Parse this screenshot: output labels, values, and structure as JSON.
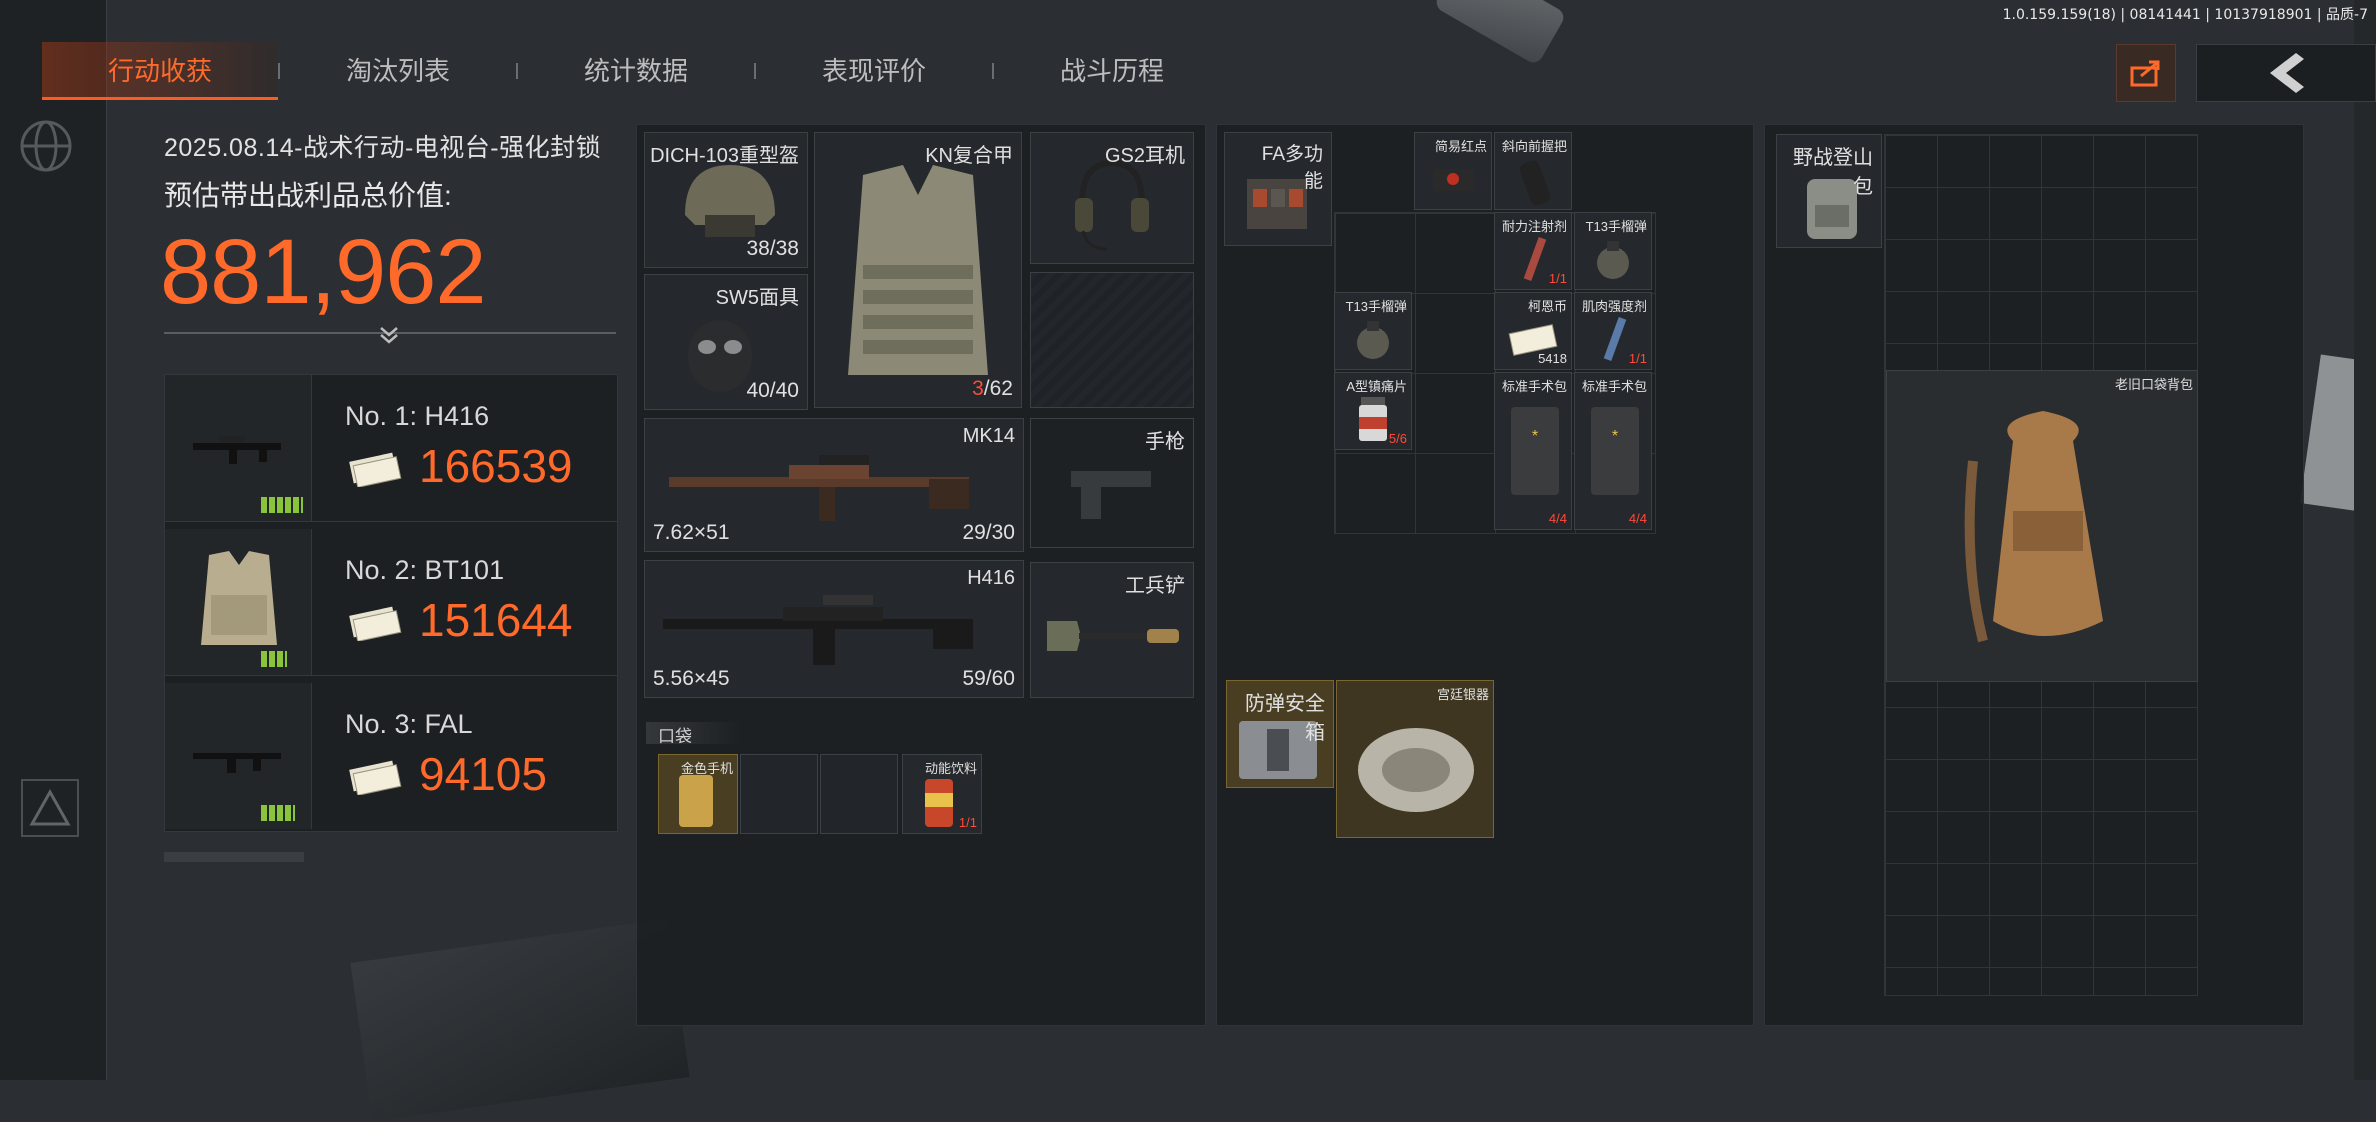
{
  "version_text": "1.0.159.159(18) | 08141441 | 10137918901 | 品质-7",
  "tabs": [
    {
      "label": "行动收获",
      "active": true
    },
    {
      "label": "淘汰列表",
      "active": false
    },
    {
      "label": "统计数据",
      "active": false
    },
    {
      "label": "表现评价",
      "active": false
    },
    {
      "label": "战斗历程",
      "active": false
    }
  ],
  "summary": {
    "operation": "2025.08.14-战术行动-电视台-强化封锁",
    "value_label": "预估带出战利品总价值:",
    "total_value": "881,962"
  },
  "top_items": [
    {
      "name": "No. 1: H416",
      "price": "166539"
    },
    {
      "name": "No. 2: BT101",
      "price": "151644"
    },
    {
      "name": "No. 3: FAL",
      "price": "94105"
    }
  ],
  "equipment": {
    "helmet": {
      "label": "DICH-103重型盔",
      "count": "38/38"
    },
    "armor": {
      "label": "KN复合甲",
      "count_cur": "3",
      "count_max": "/62"
    },
    "earphone": {
      "label": "GS2耳机"
    },
    "mask": {
      "label": "SW5面具",
      "count": "40/40"
    },
    "primary": {
      "label": "MK14",
      "caliber": "7.62×51",
      "ammo": "29/30"
    },
    "pistol": {
      "label": "手枪"
    },
    "secondary": {
      "label": "H416",
      "caliber": "5.56×45",
      "ammo": "59/60"
    },
    "melee": {
      "label": "工兵铲"
    },
    "pocket_label": "口袋",
    "pockets": [
      {
        "label": "金色手机",
        "count": ""
      },
      {
        "label": "",
        "count": ""
      },
      {
        "label": "",
        "count": ""
      },
      {
        "label": "动能饮料",
        "count": "1/1"
      }
    ]
  },
  "rig": {
    "label": "FA多功能",
    "items": [
      {
        "label": "简易红点",
        "count": ""
      },
      {
        "label": "斜向前握把",
        "count": ""
      },
      {
        "label": "耐力注射剂",
        "count": "1/1"
      },
      {
        "label": "T13手榴弹",
        "count": ""
      },
      {
        "label": "T13手榴弹",
        "count": ""
      },
      {
        "label": "柯恩币",
        "count": "5418"
      },
      {
        "label": "肌肉强度剂",
        "count": "1/1"
      },
      {
        "label": "A型镇痛片",
        "count": "5/6"
      },
      {
        "label": "标准手术包",
        "count": "4/4"
      },
      {
        "label": "标准手术包",
        "count": "4/4"
      }
    ],
    "safe_box": {
      "label": "防弹安全箱"
    },
    "safe_item": {
      "label": "宫廷银器"
    }
  },
  "backpack": {
    "label": "野战登山包",
    "item": {
      "label": "老旧口袋背包"
    }
  },
  "colors": {
    "accent": "#ff6a2b",
    "badge": "#8ac43a",
    "danger": "#ff4a3a",
    "gold_slot": "#4a3e22"
  }
}
